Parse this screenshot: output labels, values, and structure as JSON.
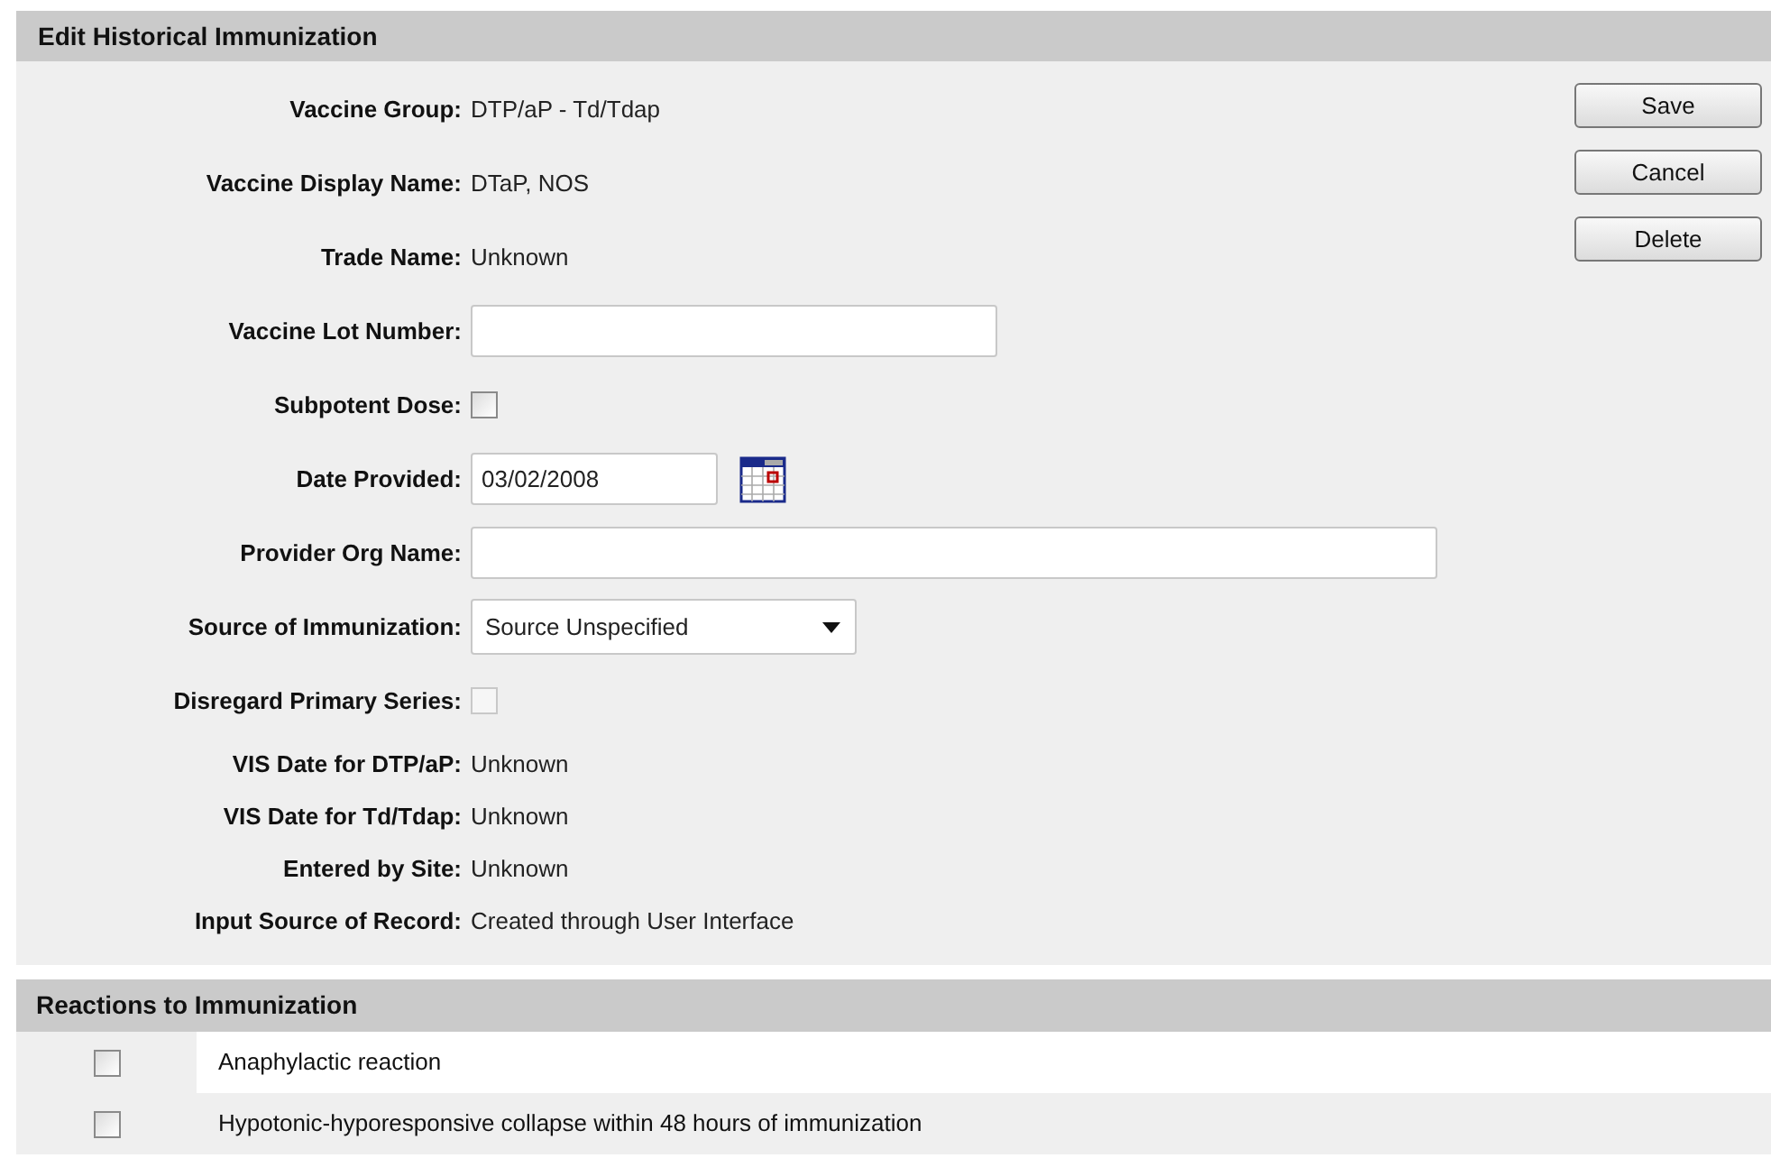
{
  "panel": {
    "title": "Edit Historical Immunization"
  },
  "fields": [
    {
      "kind": "text",
      "label": "Vaccine Group:",
      "value": "DTP/aP - Td/Tdap"
    },
    {
      "kind": "text",
      "label": "Vaccine Display Name:",
      "value": "DTaP, NOS"
    },
    {
      "kind": "text",
      "label": "Trade Name:",
      "value": "Unknown"
    },
    {
      "kind": "input",
      "label": "Vaccine Lot Number:"
    },
    {
      "kind": "checkbox",
      "label": "Subpotent Dose:",
      "checked": false,
      "disabled": false
    },
    {
      "kind": "date",
      "label": "Date Provided:",
      "value": "03/02/2008"
    },
    {
      "kind": "wideinput",
      "label": "Provider Org Name:"
    },
    {
      "kind": "select",
      "label": "Source of Immunization:",
      "value": "Source Unspecified"
    },
    {
      "kind": "checkbox",
      "label": "Disregard Primary Series:",
      "checked": false,
      "disabled": true
    },
    {
      "kind": "info",
      "label": "VIS Date for DTP/aP:",
      "value": "Unknown"
    },
    {
      "kind": "info",
      "label": "VIS Date for Td/Tdap:",
      "value": "Unknown"
    },
    {
      "kind": "info",
      "label": "Entered by Site:",
      "value": "Unknown"
    },
    {
      "kind": "info",
      "label": "Input Source of Record:",
      "value": "Created through User Interface"
    }
  ],
  "buttons": [
    "Save",
    "Cancel",
    "Delete"
  ],
  "reactions": {
    "title": "Reactions to Immunization",
    "items": [
      {
        "label": "Anaphylactic reaction",
        "checked": false
      },
      {
        "label": "Hypotonic-hyporesponsive collapse within 48 hours of immunization",
        "checked": false
      }
    ]
  }
}
